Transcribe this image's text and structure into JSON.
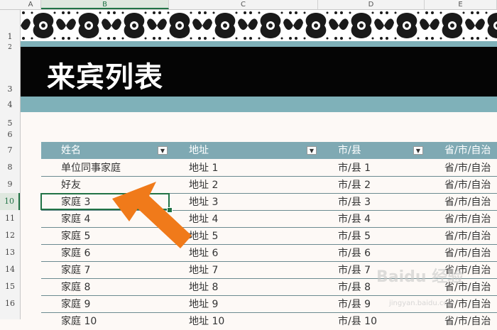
{
  "columns": [
    "A",
    "B",
    "C",
    "D",
    "E"
  ],
  "rows": [
    "1",
    "2",
    "3",
    "4",
    "5",
    "6",
    "7",
    "8",
    "9",
    "10",
    "11",
    "12",
    "13",
    "14",
    "15",
    "16"
  ],
  "title": "来宾列表",
  "table": {
    "headers": [
      "姓名",
      "地址",
      "市/县",
      "省/市/自治"
    ],
    "dropdown_icon": "▼",
    "rows": [
      [
        "单位同事家庭",
        "地址 1",
        "市/县 1",
        "省/市/自治"
      ],
      [
        "好友",
        "地址 2",
        "市/县 2",
        "省/市/自治"
      ],
      [
        "家庭 3",
        "地址 3",
        "市/县 3",
        "省/市/自治"
      ],
      [
        "家庭 4",
        "地址 4",
        "市/县 4",
        "省/市/自治"
      ],
      [
        "家庭 5",
        "地址 5",
        "市/县 5",
        "省/市/自治"
      ],
      [
        "家庭 6",
        "地址 6",
        "市/县 6",
        "省/市/自治"
      ],
      [
        "家庭 7",
        "地址 7",
        "市/县 7",
        "省/市/自治"
      ],
      [
        "家庭 8",
        "地址 8",
        "市/县 8",
        "省/市/自治"
      ],
      [
        "家庭 9",
        "地址 9",
        "市/县 9",
        "省/市/自治"
      ],
      [
        "家庭 10",
        "地址 10",
        "市/县 10",
        "省/市/自治"
      ]
    ]
  },
  "watermark": "Baidu 经验",
  "watermark_url": "jingyan.baidu.com",
  "colors": {
    "accent_green": "#217346",
    "teal": "#7fb1b9",
    "header_teal": "#7fa9b3",
    "arrow": "#f07a1a"
  }
}
